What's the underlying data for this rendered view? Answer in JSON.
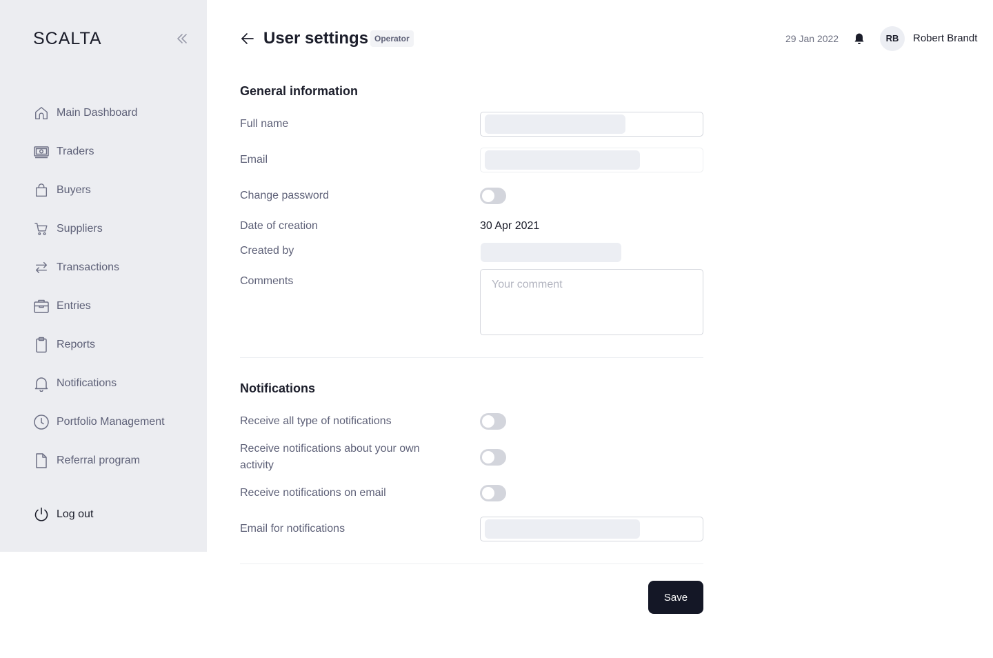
{
  "sidebar": {
    "logo": "SCALTA",
    "items": [
      {
        "label": "Main Dashboard",
        "icon": "home-icon"
      },
      {
        "label": "Traders",
        "icon": "banknote-icon"
      },
      {
        "label": "Buyers",
        "icon": "shopping-bag-icon"
      },
      {
        "label": "Suppliers",
        "icon": "cart-icon"
      },
      {
        "label": "Transactions",
        "icon": "swap-arrows-icon"
      },
      {
        "label": "Entries",
        "icon": "briefcase-icon"
      },
      {
        "label": "Reports",
        "icon": "clipboard-icon"
      },
      {
        "label": "Notifications",
        "icon": "bell-icon"
      },
      {
        "label": "Portfolio Management",
        "icon": "clock-icon"
      },
      {
        "label": "Referral program",
        "icon": "file-icon"
      }
    ],
    "logout_label": "Log out"
  },
  "header": {
    "title": "User settings",
    "role_badge": "Operator",
    "date": "29 Jan 2022",
    "avatar_initials": "RB",
    "user_name": "Robert Brandt"
  },
  "general": {
    "section_title": "General information",
    "full_name_label": "Full name",
    "email_label": "Email",
    "change_password_label": "Change password",
    "date_of_creation_label": "Date of creation",
    "date_of_creation_value": "30 Apr 2021",
    "created_by_label": "Created by",
    "comments_label": "Comments",
    "comments_placeholder": "Your comment"
  },
  "notifications": {
    "section_title": "Notifications",
    "receive_all_label": "Receive all type of notifications",
    "receive_own_label": "Receive notifications about your own activity",
    "receive_email_label": "Receive notifications on email",
    "email_for_notifications_label": "Email for notifications"
  },
  "footer": {
    "save_label": "Save"
  },
  "colors": {
    "sidebar_bg": "#ecedf1",
    "primary_button": "#141726",
    "toggle_off": "#d3d5dc"
  }
}
